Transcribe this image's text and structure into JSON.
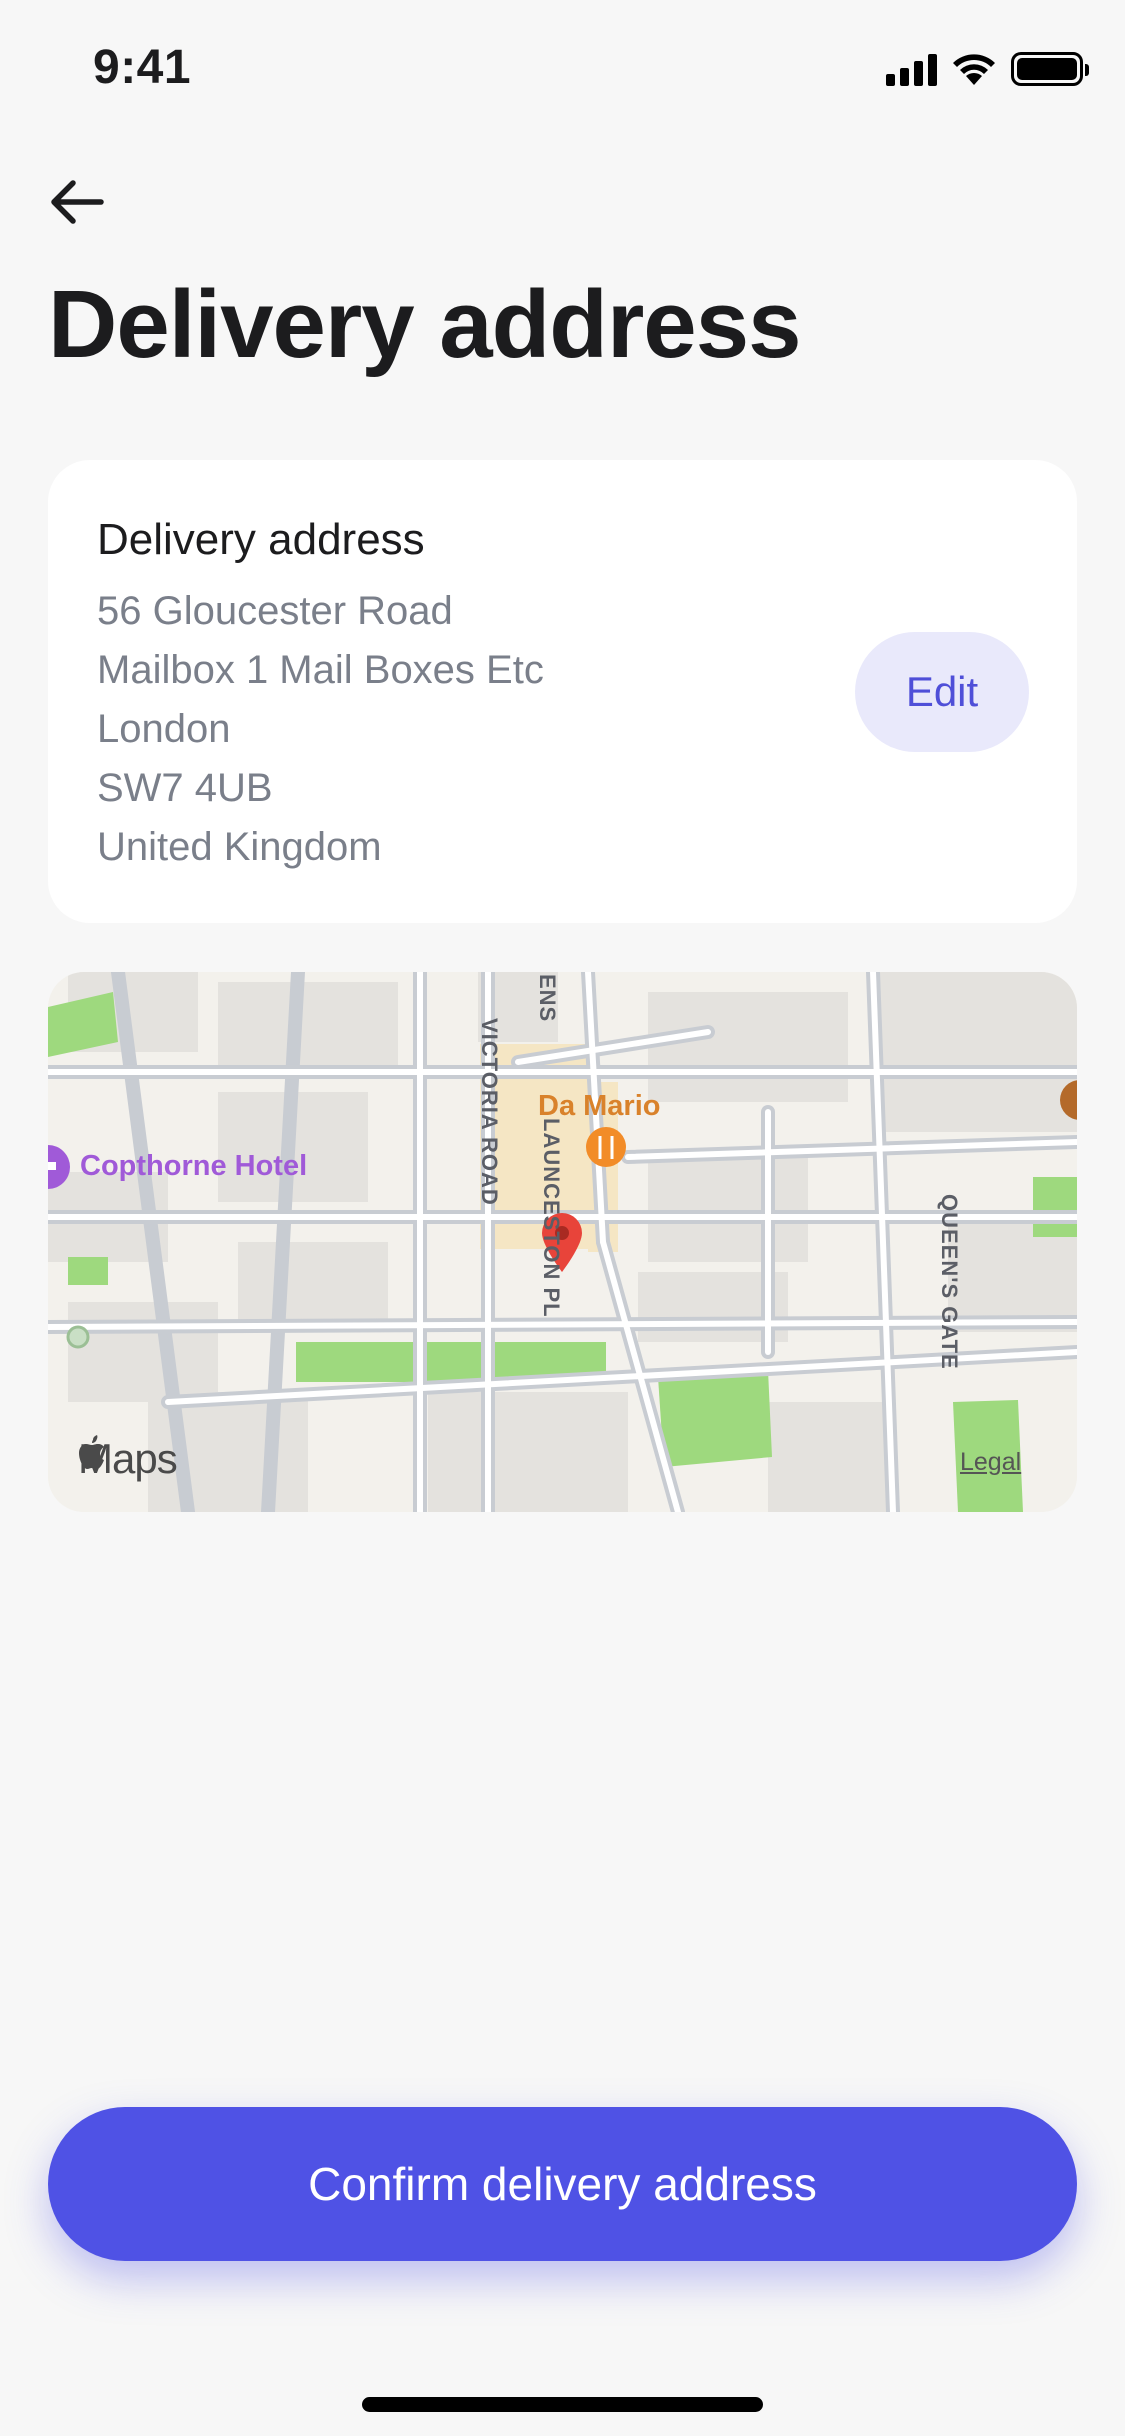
{
  "status_bar": {
    "time": "9:41",
    "icons": [
      "signal-icon",
      "wifi-icon",
      "battery-icon"
    ]
  },
  "header": {
    "back_icon": "arrow-left-icon",
    "title": "Delivery address"
  },
  "address_card": {
    "heading": "Delivery address",
    "lines": [
      "56 Gloucester Road",
      "Mailbox 1 Mail Boxes Etc",
      "London",
      "SW7 4UB",
      "United Kingdom"
    ],
    "edit_label": "Edit"
  },
  "map": {
    "streets": [
      "VICTORIA ROAD",
      "LAUNCESTON PL",
      "QUEEN'S GATE",
      "ENS"
    ],
    "poi_hotel": "Copthorne Hotel",
    "poi_restaurant": "Da Mario",
    "provider": "Maps",
    "legal": "Legal",
    "pin_icon": "map-pin-icon"
  },
  "footer": {
    "confirm_label": "Confirm delivery address"
  },
  "colors": {
    "accent": "#4f52e5",
    "edit_bg": "#e9e9fb",
    "pin": "#e8443a",
    "park": "#9ed97e",
    "restaurant": "#d9822b",
    "hotel": "#a05ad8"
  }
}
